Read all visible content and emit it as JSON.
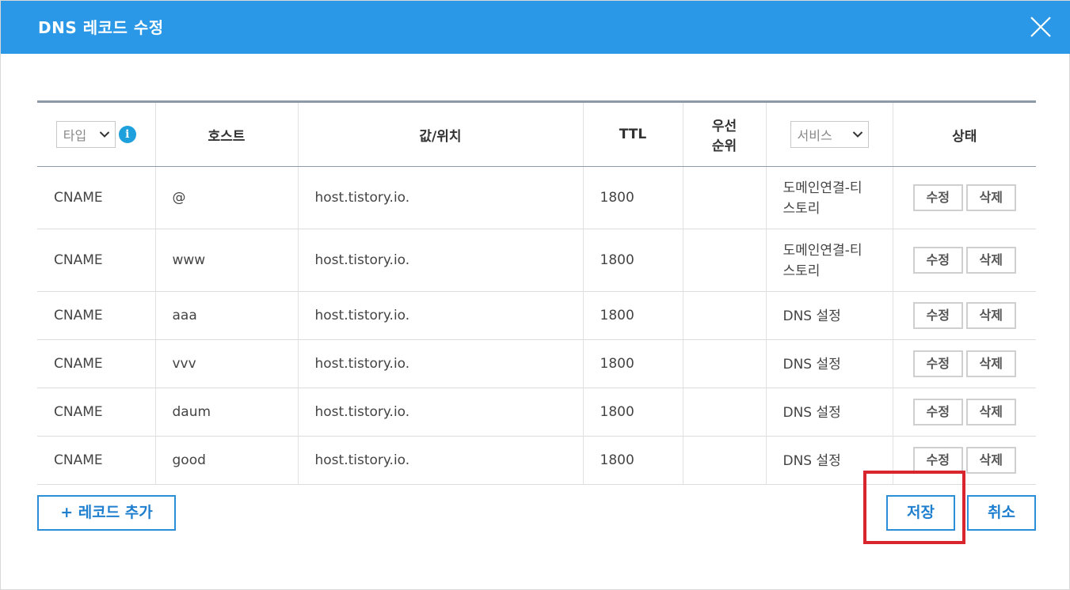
{
  "dialog": {
    "title": "DNS 레코드 수정"
  },
  "table": {
    "headers": {
      "type_select": "타입",
      "info_icon": "i",
      "host": "호스트",
      "value": "값/위치",
      "ttl": "TTL",
      "priority_line1": "우선",
      "priority_line2": "순위",
      "service_select": "서비스",
      "status": "상태"
    },
    "rows": [
      {
        "type": "CNAME",
        "host": "@",
        "value": "host.tistory.io.",
        "ttl": "1800",
        "priority": "",
        "service_line1": "도메인연결-티",
        "service_line2": "스토리",
        "edit": "수정",
        "delete": "삭제"
      },
      {
        "type": "CNAME",
        "host": "www",
        "value": "host.tistory.io.",
        "ttl": "1800",
        "priority": "",
        "service_line1": "도메인연결-티",
        "service_line2": "스토리",
        "edit": "수정",
        "delete": "삭제"
      },
      {
        "type": "CNAME",
        "host": "aaa",
        "value": "host.tistory.io.",
        "ttl": "1800",
        "priority": "",
        "service_line1": "DNS 설정",
        "service_line2": "",
        "edit": "수정",
        "delete": "삭제"
      },
      {
        "type": "CNAME",
        "host": "vvv",
        "value": "host.tistory.io.",
        "ttl": "1800",
        "priority": "",
        "service_line1": "DNS 설정",
        "service_line2": "",
        "edit": "수정",
        "delete": "삭제"
      },
      {
        "type": "CNAME",
        "host": "daum",
        "value": "host.tistory.io.",
        "ttl": "1800",
        "priority": "",
        "service_line1": "DNS 설정",
        "service_line2": "",
        "edit": "수정",
        "delete": "삭제"
      },
      {
        "type": "CNAME",
        "host": "good",
        "value": "host.tistory.io.",
        "ttl": "1800",
        "priority": "",
        "service_line1": "DNS 설정",
        "service_line2": "",
        "edit": "수정",
        "delete": "삭제"
      }
    ]
  },
  "footer": {
    "add_record": "+ 레코드 추가",
    "save": "저장",
    "cancel": "취소"
  },
  "colors": {
    "header_bg": "#2a98e6",
    "button_blue": "#2a8fd8",
    "highlight_red": "#d9262e"
  }
}
